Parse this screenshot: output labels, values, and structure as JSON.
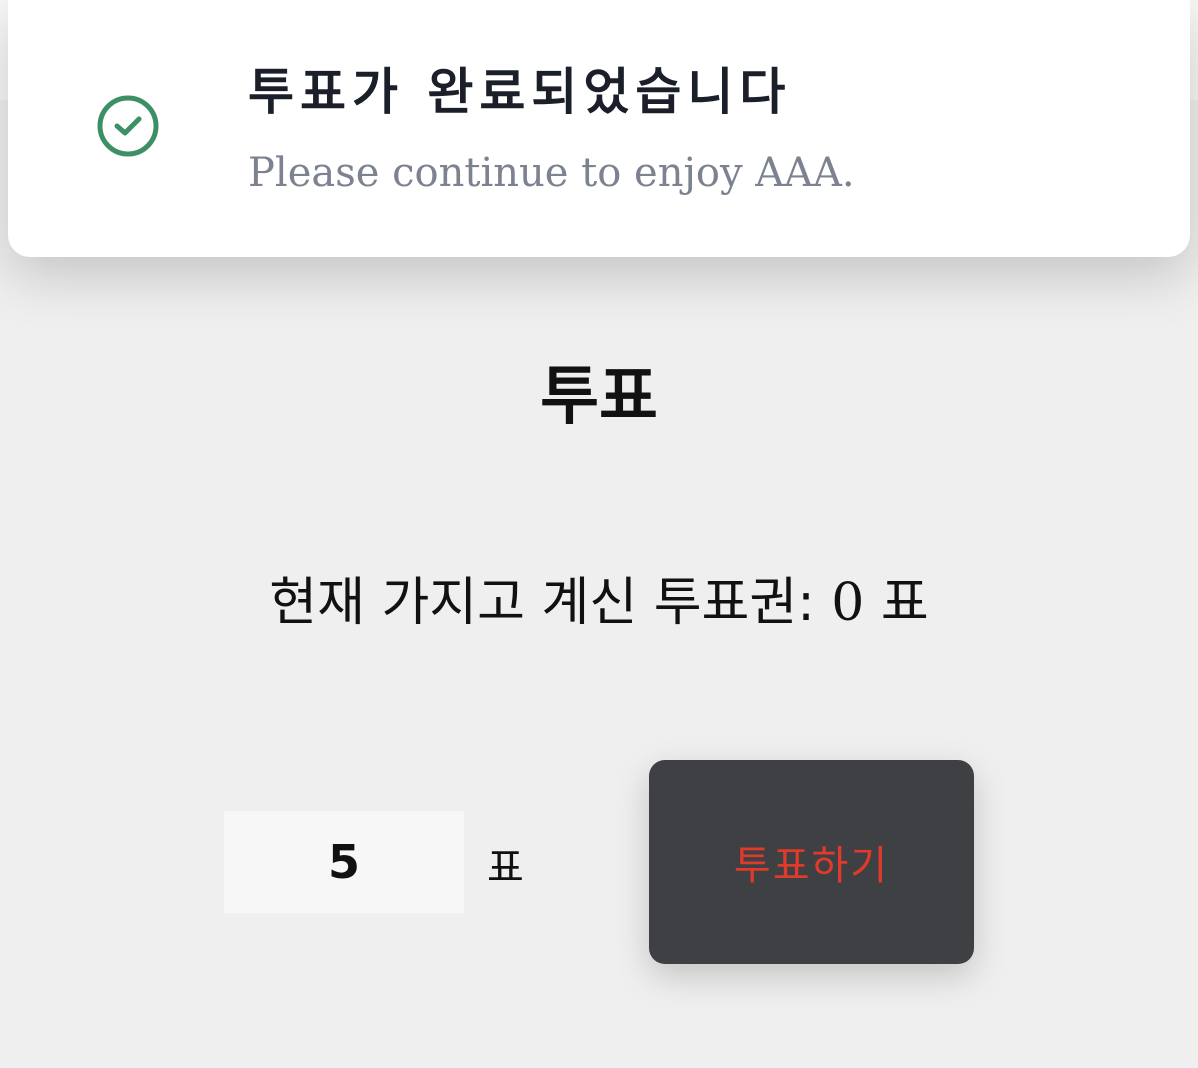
{
  "toast": {
    "title": "투표가 완료되었습니다",
    "subtitle": "Please continue to enjoy AAA.",
    "icon": "check-circle-icon",
    "icon_color": "#3d8f66"
  },
  "main": {
    "title": "투표",
    "ticket_label": "현재 가지고 계신 투표권: ",
    "ticket_count": "0",
    "ticket_unit": "표",
    "vote_input_value": "5",
    "vote_unit": "표",
    "vote_button_label": "투표하기",
    "vote_button_text_color": "#e03a2b",
    "vote_button_bg_color": "#3f4044"
  }
}
